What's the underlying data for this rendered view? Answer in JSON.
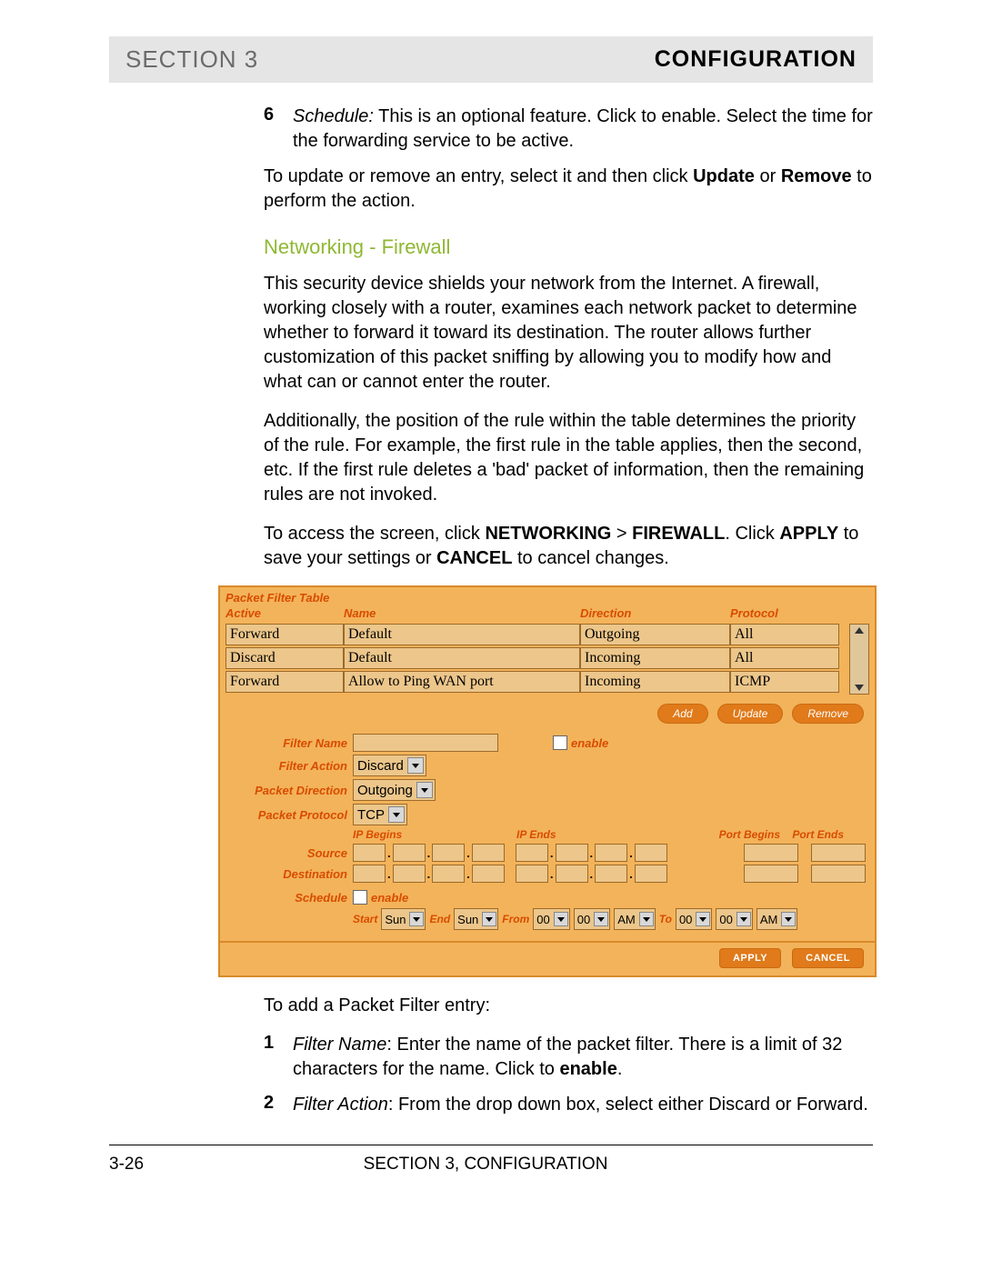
{
  "header": {
    "left": "SECTION 3",
    "right": "CONFIGURATION"
  },
  "intro_item": {
    "num": "6",
    "label": "Schedule:",
    "text": " This is an optional feature. Click to enable. Select the time for the forwarding service to be active."
  },
  "para_update": {
    "pre": "To update or remove an entry, select it and then click ",
    "b1": "Update",
    "mid": " or ",
    "b2": "Remove",
    "post": " to perform the action."
  },
  "heading": "Networking - Firewall",
  "para1": "This security device shields your network from the Internet. A firewall, working closely with a router, examines each network packet to determine whether to forward it toward its destination. The router allows further customization of this packet sniffing by allowing you to modify how and what can or cannot enter the router.",
  "para2": "Additionally, the position of the rule within the table determines the priority of the rule. For example, the first rule in the table applies, then the second, etc. If the first rule deletes a 'bad' packet of information, then the remaining rules are not invoked.",
  "para3": {
    "pre": "To access the screen, click ",
    "b1": "NETWORKING",
    "gt": " > ",
    "b2": "FIREWALL",
    "mid": ". Click ",
    "b3": "APPLY",
    "mid2": " to save your settings or ",
    "b4": "CANCEL",
    "post": " to cancel changes."
  },
  "panel": {
    "title": "Packet Filter Table",
    "cols": {
      "c1": "Active",
      "c2": "Name",
      "c3": "Direction",
      "c4": "Protocol"
    },
    "rows": [
      {
        "c1": "Forward",
        "c2": "Default",
        "c3": "Outgoing",
        "c4": "All"
      },
      {
        "c1": "Discard",
        "c2": "Default",
        "c3": "Incoming",
        "c4": "All"
      },
      {
        "c1": "Forward",
        "c2": "Allow to Ping WAN port",
        "c3": "Incoming",
        "c4": "ICMP"
      }
    ],
    "buttons": {
      "add": "Add",
      "update": "Update",
      "remove": "Remove"
    },
    "form": {
      "filter_name_label": "Filter Name",
      "enable_label": "enable",
      "filter_action_label": "Filter Action",
      "filter_action_value": "Discard",
      "packet_direction_label": "Packet Direction",
      "packet_direction_value": "Outgoing",
      "packet_protocol_label": "Packet Protocol",
      "packet_protocol_value": "TCP",
      "ip_begins": "IP Begins",
      "ip_ends": "IP Ends",
      "port_begins": "Port Begins",
      "port_ends": "Port Ends",
      "source": "Source",
      "destination": "Destination",
      "schedule": "Schedule",
      "start": "Start",
      "end": "End",
      "from": "From",
      "to": "To",
      "day1": "Sun",
      "day2": "Sun",
      "h1": "00",
      "m1": "00",
      "ap1": "AM",
      "h2": "00",
      "m2": "00",
      "ap2": "AM"
    },
    "footer": {
      "apply": "APPLY",
      "cancel": "CANCEL"
    }
  },
  "after_panel": "To add a Packet Filter entry:",
  "steps": [
    {
      "n": "1",
      "label": "Filter Name",
      "text": ": Enter the name of the packet filter. There is a limit of 32 characters for the name. Click to ",
      "b": "enable",
      "post": "."
    },
    {
      "n": "2",
      "label": "Filter Action",
      "text": ": From the drop down box, select either Discard or Forward.",
      "b": "",
      "post": ""
    }
  ],
  "footer": {
    "page": "3-26",
    "title": "SECTION 3, CONFIGURATION"
  }
}
